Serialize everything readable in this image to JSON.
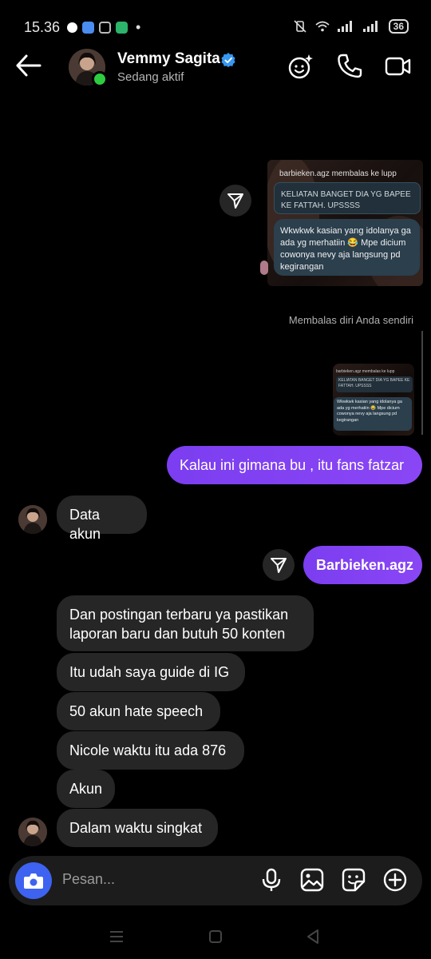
{
  "status_bar": {
    "time": "15.36",
    "battery": "36"
  },
  "header": {
    "contact_name": "Vemmy Sagita",
    "activity_status": "Sedang aktif",
    "icons": [
      "back-arrow-icon",
      "verified-badge-icon",
      "effects-icon",
      "phone-icon",
      "video-icon"
    ]
  },
  "shared_story": {
    "username_line": "barbieken.agz membalas ke lupp",
    "reply_quote": "KELIATAN BANGET DIA YG BAPEE KE FATTAH. UPSSSS",
    "reply_message": "Wkwkwk kasian yang idolanya ga ada yg merhatiin 😂 Mpe dicium cowonya nevy aja langsung pd kegirangan"
  },
  "reply_note": "Membalas diri Anda sendiri",
  "reply_thumbnail": {
    "username_line": "barbieken.agz membalas ke lupp",
    "reply_quote": "KELIATAN BANGET DIA YG BAPEE KE FATTAH. UPSSSS",
    "reply_message": "Wkwkwk kasian yang idolanya ga ada yg merhatiin 😂 Mpe dicium cowonya nevy aja langsung pd kegirangan"
  },
  "messages": [
    {
      "text": "Kalau ini gimana bu , itu fans fatzar",
      "direction": "out"
    },
    {
      "text": "Data akun",
      "direction": "in"
    },
    {
      "text": "Barbieken.agz",
      "direction": "out"
    },
    {
      "text": "Dan postingan terbaru ya pastikan laporan baru dan butuh 50 konten",
      "direction": "in"
    },
    {
      "text": "Itu udah saya guide di IG",
      "direction": "in"
    },
    {
      "text": "50 akun hate speech",
      "direction": "in"
    },
    {
      "text": "Nicole waktu itu ada 876",
      "direction": "in"
    },
    {
      "text": "Akun",
      "direction": "in"
    },
    {
      "text": "Dalam waktu singkat",
      "direction": "in"
    }
  ],
  "composer": {
    "placeholder": "Pesan...",
    "icons": [
      "camera-icon",
      "microphone-icon",
      "gallery-icon",
      "sticker-icon",
      "plus-icon"
    ]
  },
  "colors": {
    "outgoing_bubble": "#7c3aed",
    "incoming_bubble": "#262626",
    "camera_button": "#3d63f0",
    "online_dot": "#2ecc40",
    "verified": "#3897f0"
  }
}
